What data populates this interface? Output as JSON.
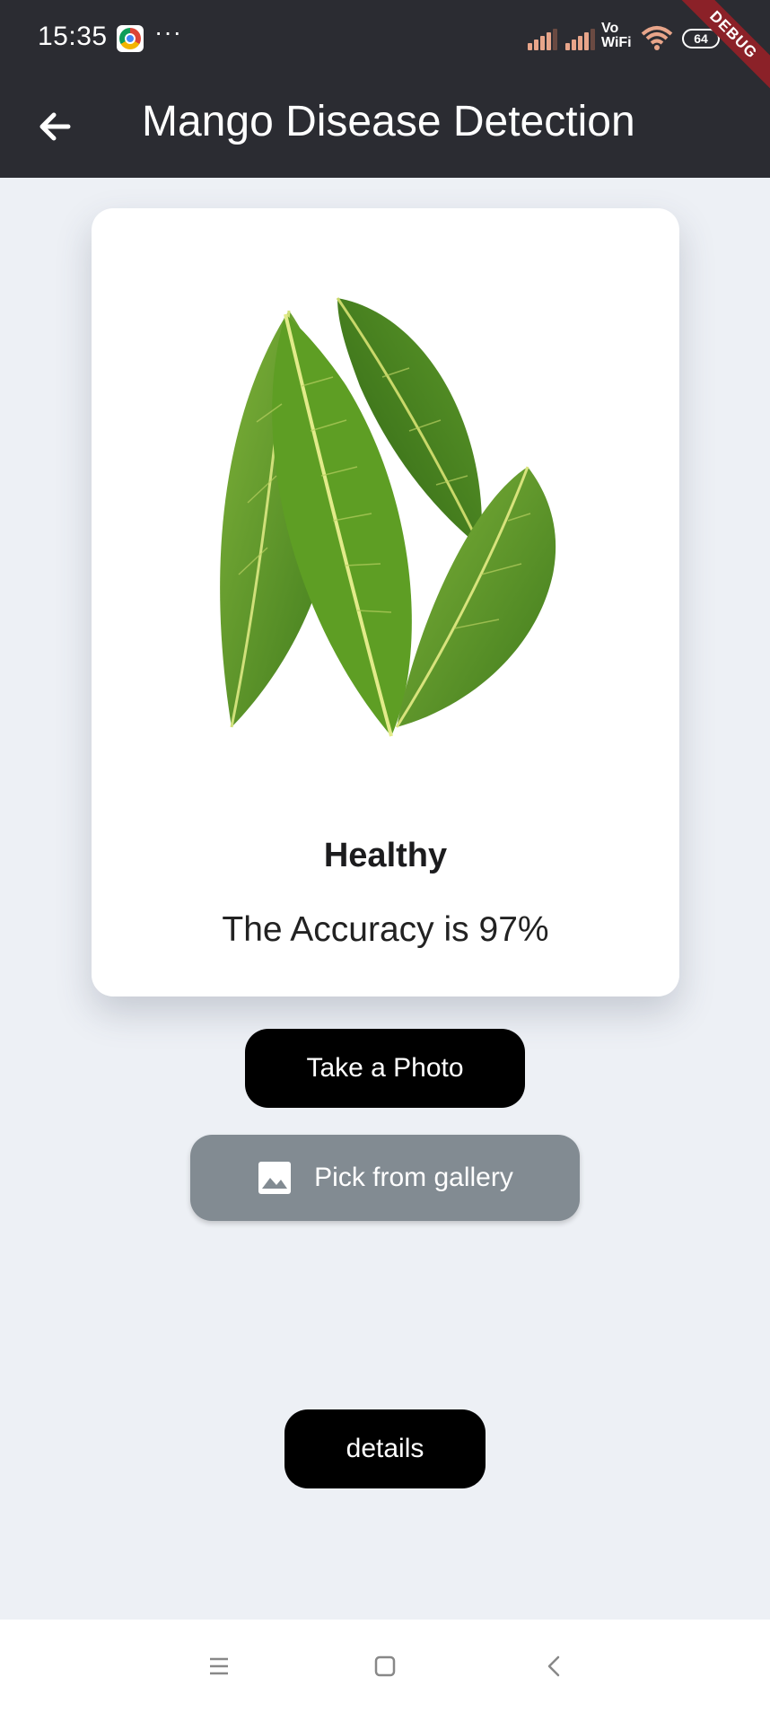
{
  "status_bar": {
    "time": "15:35",
    "more": "···",
    "network_label": "Vo\nWiFi",
    "battery": "64",
    "icons": [
      "chrome-icon",
      "signal-icon",
      "signal-icon",
      "wifi-icon",
      "battery-icon"
    ]
  },
  "debug_banner": "DEBUG",
  "app_bar": {
    "title": "Mango Disease Detection",
    "back_icon": "arrow-back-icon"
  },
  "result": {
    "label": "Healthy",
    "accuracy_text": "The Accuracy is 97%"
  },
  "buttons": {
    "take_photo": "Take a Photo",
    "pick_gallery": "Pick from gallery",
    "details": "details"
  },
  "nav": {
    "icons": [
      "menu-icon",
      "home-icon",
      "back-icon"
    ]
  },
  "colors": {
    "app_bar": "#2b2c32",
    "background": "#edf0f5",
    "primary_button": "#000000",
    "gallery_button": "#828b92",
    "debug_ribbon": "#8b2128"
  }
}
